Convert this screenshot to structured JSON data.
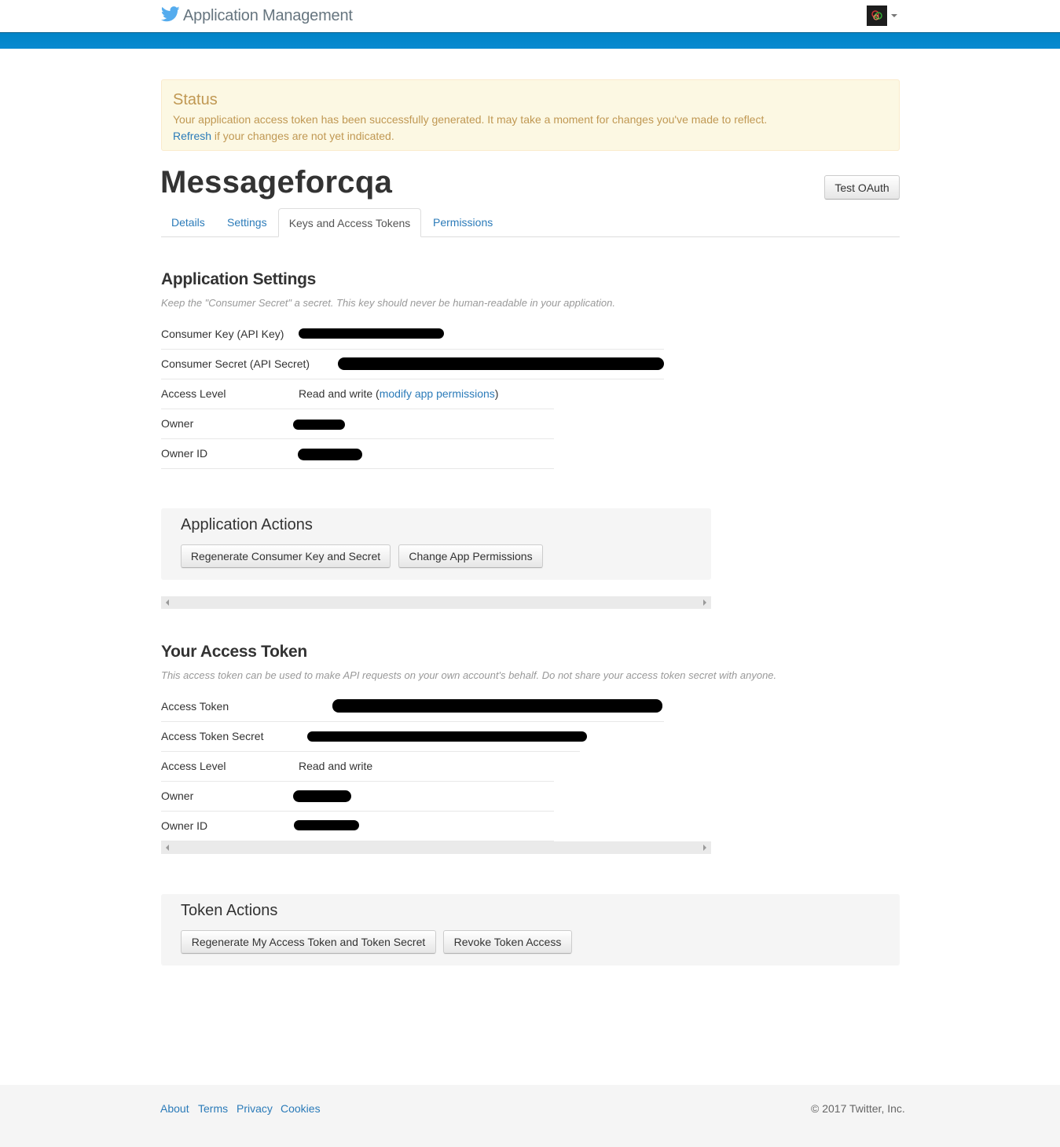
{
  "header": {
    "title": "Application Management",
    "bird_icon": "twitter-bird-icon",
    "accent_color": "#0084c7"
  },
  "status": {
    "title": "Status",
    "message": "Your application access token has been successfully generated. It may take a moment for changes you've made to reflect.",
    "refresh_link": "Refresh",
    "refresh_suffix": " if your changes are not yet indicated."
  },
  "app": {
    "name": "Messageforcqa",
    "test_oauth_label": "Test OAuth"
  },
  "tabs": [
    {
      "label": "Details"
    },
    {
      "label": "Settings"
    },
    {
      "label": "Keys and Access Tokens"
    },
    {
      "label": "Permissions"
    }
  ],
  "application_settings": {
    "heading": "Application Settings",
    "note": "Keep the \"Consumer Secret\" a secret. This key should never be human-readable in your application.",
    "rows": [
      {
        "label": "Consumer Key (API Key)"
      },
      {
        "label": "Consumer Secret (API Secret)"
      },
      {
        "label": "Access Level",
        "value": "Read and write (",
        "link": "modify app permissions",
        "suffix": ")"
      },
      {
        "label": "Owner"
      },
      {
        "label": "Owner ID"
      }
    ]
  },
  "application_actions": {
    "heading": "Application Actions",
    "buttons": [
      "Regenerate Consumer Key and Secret",
      "Change App Permissions"
    ]
  },
  "access_token": {
    "heading": "Your Access Token",
    "note": "This access token can be used to make API requests on your own account's behalf. Do not share your access token secret with anyone.",
    "rows": [
      {
        "label": "Access Token"
      },
      {
        "label": "Access Token Secret"
      },
      {
        "label": "Access Level",
        "value": "Read and write"
      },
      {
        "label": "Owner"
      },
      {
        "label": "Owner ID"
      }
    ]
  },
  "token_actions": {
    "heading": "Token Actions",
    "buttons": [
      "Regenerate My Access Token and Token Secret",
      "Revoke Token Access"
    ]
  },
  "footer": {
    "links": [
      "About",
      "Terms",
      "Privacy",
      "Cookies"
    ],
    "copyright": "© 2017 Twitter, Inc."
  }
}
